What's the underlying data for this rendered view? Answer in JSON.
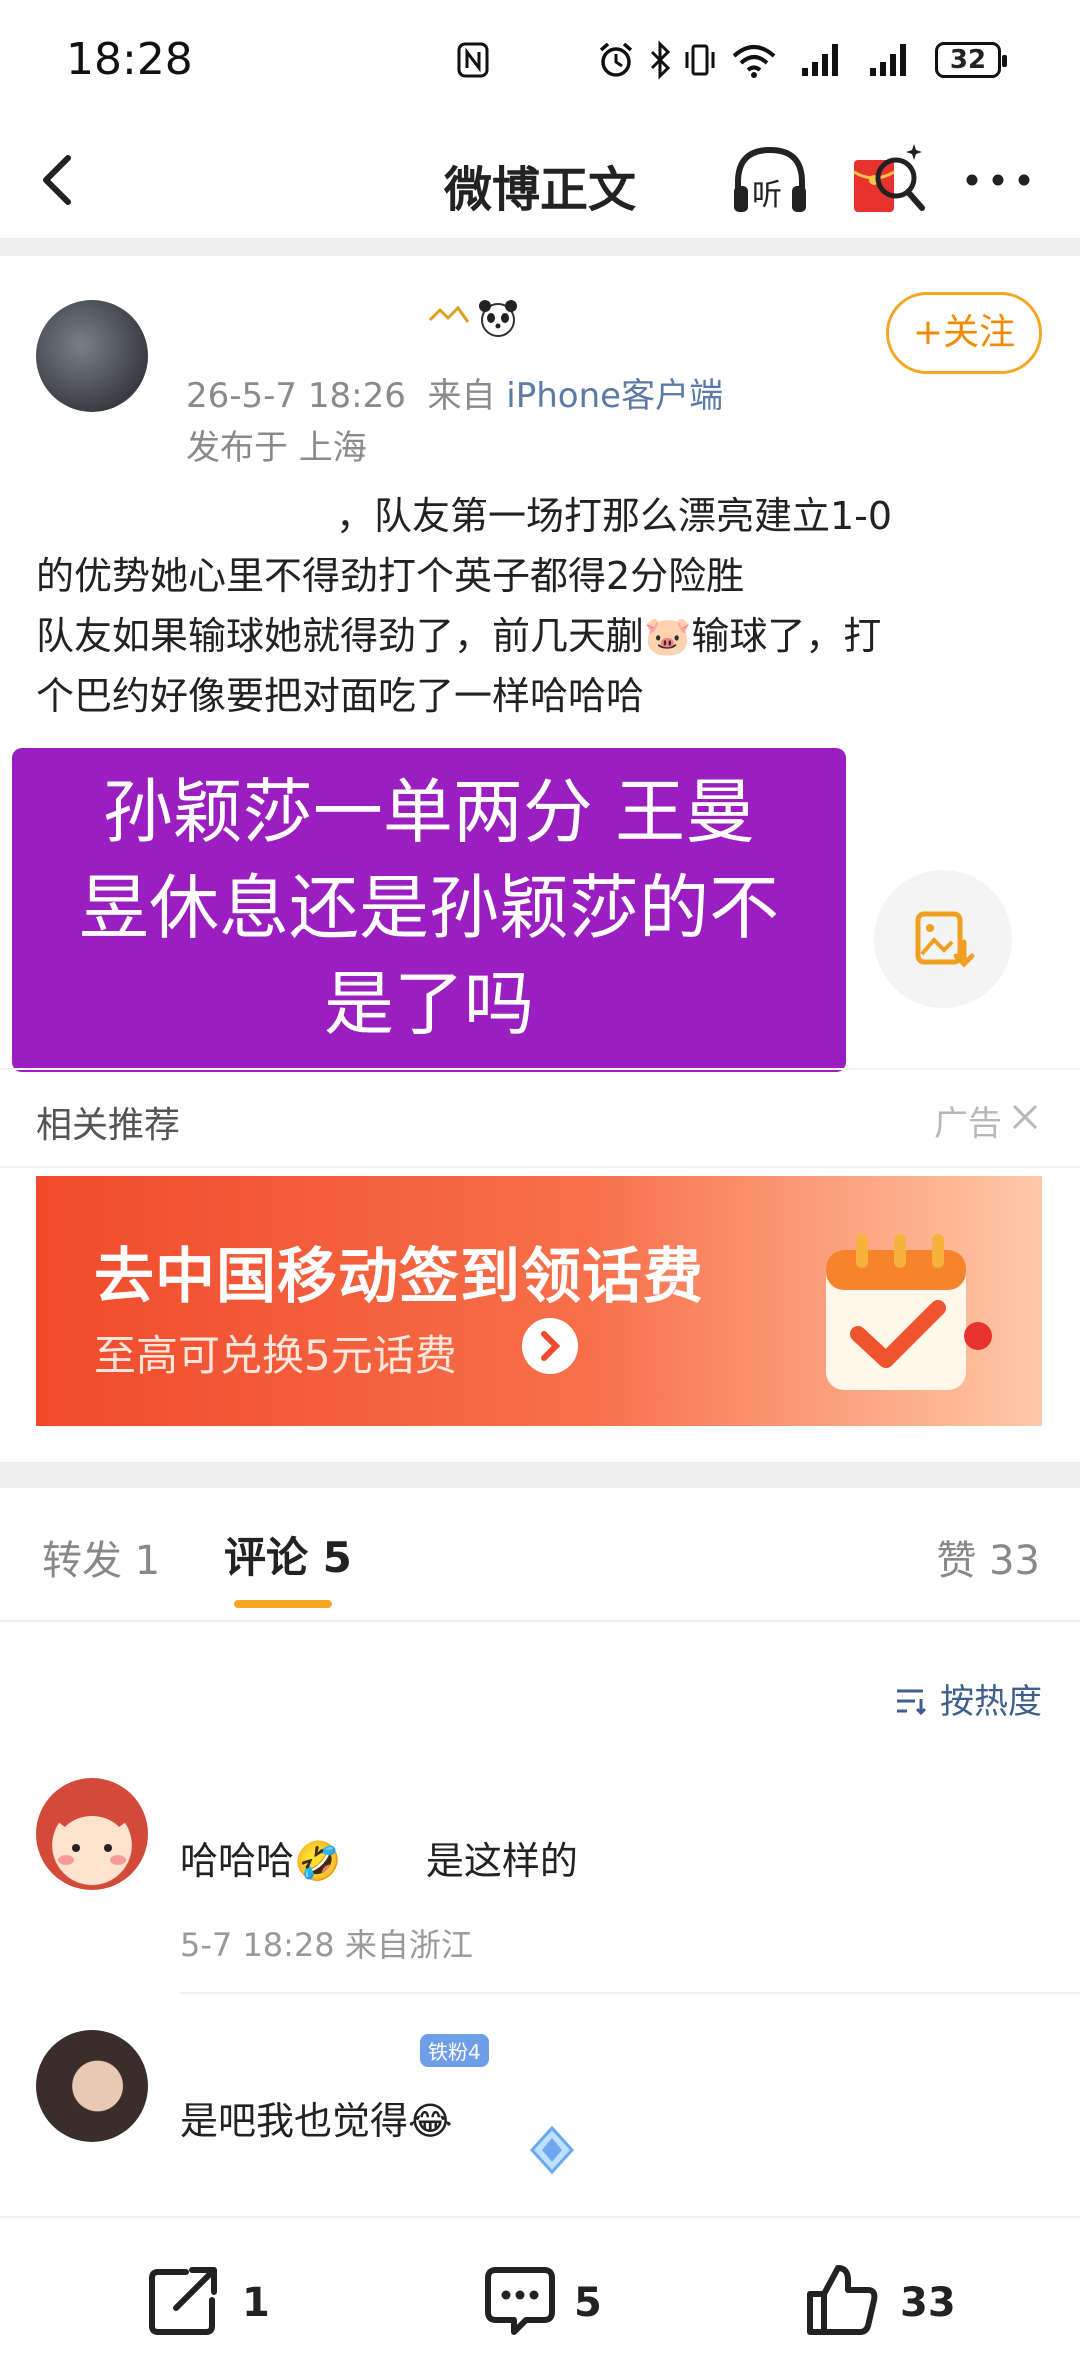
{
  "status_bar": {
    "time": "18:28",
    "battery": "32",
    "signal_icons": [
      "nfc-icon",
      "alarm-icon",
      "bluetooth-icon",
      "vibrate-icon",
      "wifi-icon",
      "signal-icon",
      "signal-icon"
    ]
  },
  "nav": {
    "title": "微博正文",
    "listen_label": "听"
  },
  "post": {
    "author_name": "",
    "timestamp": "26-5-7 18:26",
    "source_prefix": "来自",
    "source": "iPhone客户端",
    "location": "发布于 上海",
    "follow_label": "+关注",
    "body_lines": [
      "，队友第一场打那么漂亮建立1-0",
      "的优势她心里不得劲打个英子都得2分险胜",
      "队友如果输球她就得劲了，前几天蒯🐷输球了，打",
      "个巴约好像要把对面吃了一样哈哈哈"
    ],
    "card_lines": [
      "孙颖莎一单两分 王曼",
      "昱休息还是孙颖莎的不",
      "是了吗"
    ]
  },
  "related": {
    "label": "相关推荐",
    "ad_label": "广告",
    "ad_title": "去中国移动签到领话费",
    "ad_subtitle": "至高可兑换5元话费"
  },
  "tabs": {
    "repost_label": "转发",
    "repost_count": "1",
    "comment_label": "评论",
    "comment_count": "5",
    "like_label": "赞",
    "like_count": "33"
  },
  "sort_label": "按热度",
  "comments": [
    {
      "name": "",
      "text": "哈哈哈🤣",
      "text_tail": "是这样的",
      "meta": "5-7 18:28  来自浙江"
    },
    {
      "name": "",
      "badge": "铁粉4",
      "text": "是吧我也觉得😂"
    }
  ],
  "bottom_bar": {
    "repost_count": "1",
    "comment_count": "5",
    "like_count": "33"
  },
  "colors": {
    "accent_orange": "#f5a623",
    "card_purple": "#9b1fc0",
    "ad_red": "#f04a2c",
    "link_blue": "#3f5f8f"
  }
}
